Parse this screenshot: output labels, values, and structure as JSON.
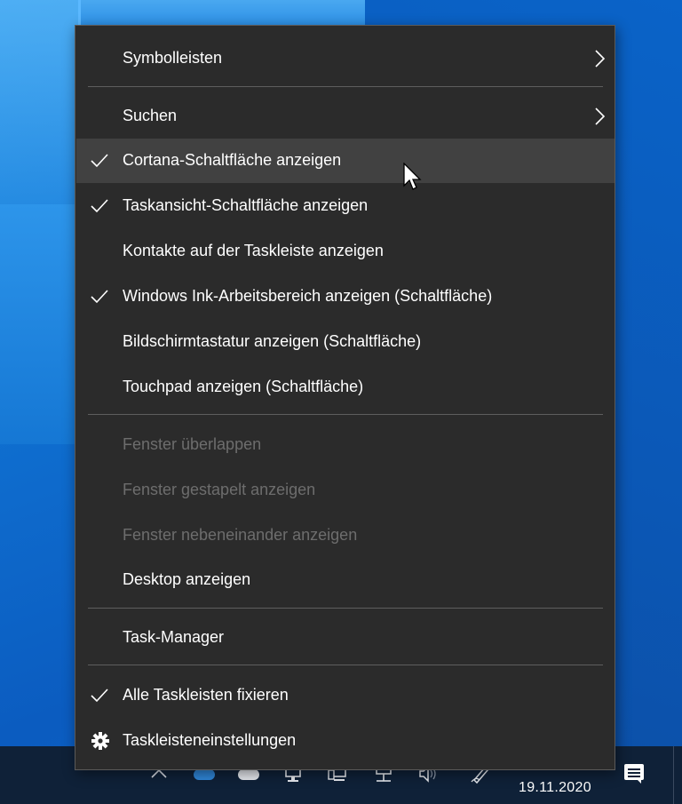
{
  "menu": {
    "items": [
      {
        "label": "Symbolleisten",
        "checked": false,
        "submenu": true,
        "disabled": false
      },
      {
        "label": "Suchen",
        "checked": false,
        "submenu": true,
        "disabled": false
      },
      {
        "label": "Cortana-Schaltfläche anzeigen",
        "checked": true,
        "submenu": false,
        "disabled": false,
        "hover": true
      },
      {
        "label": "Taskansicht-Schaltfläche anzeigen",
        "checked": true,
        "submenu": false,
        "disabled": false
      },
      {
        "label": "Kontakte auf der Taskleiste anzeigen",
        "checked": false,
        "submenu": false,
        "disabled": false
      },
      {
        "label": "Windows Ink-Arbeitsbereich anzeigen (Schaltfläche)",
        "checked": true,
        "submenu": false,
        "disabled": false
      },
      {
        "label": "Bildschirmtastatur anzeigen (Schaltfläche)",
        "checked": false,
        "submenu": false,
        "disabled": false
      },
      {
        "label": "Touchpad anzeigen (Schaltfläche)",
        "checked": false,
        "submenu": false,
        "disabled": false
      },
      {
        "label": "Fenster überlappen",
        "checked": false,
        "submenu": false,
        "disabled": true
      },
      {
        "label": "Fenster gestapelt anzeigen",
        "checked": false,
        "submenu": false,
        "disabled": true
      },
      {
        "label": "Fenster nebeneinander anzeigen",
        "checked": false,
        "submenu": false,
        "disabled": true
      },
      {
        "label": "Desktop anzeigen",
        "checked": false,
        "submenu": false,
        "disabled": false
      },
      {
        "label": "Task-Manager",
        "checked": false,
        "submenu": false,
        "disabled": false
      },
      {
        "label": "Alle Taskleisten fixieren",
        "checked": true,
        "submenu": false,
        "disabled": false
      },
      {
        "label": "Taskleisteneinstellungen",
        "checked": false,
        "submenu": false,
        "disabled": false,
        "icon": "gear-icon"
      }
    ]
  },
  "taskbar": {
    "date": "19.11.2020",
    "tray_icons": [
      "chevron-up-icon",
      "onedrive-icon",
      "onedrive-icon",
      "network-pc-icon",
      "network-pc-icon",
      "network-icon",
      "volume-icon",
      "pen-icon"
    ]
  },
  "colors": {
    "menu_bg": "#2b2b2b",
    "menu_hover": "#414141",
    "separator": "#5e5e5e",
    "disabled_text": "#6d6d6d",
    "taskbar_bg": "#0f2138"
  }
}
